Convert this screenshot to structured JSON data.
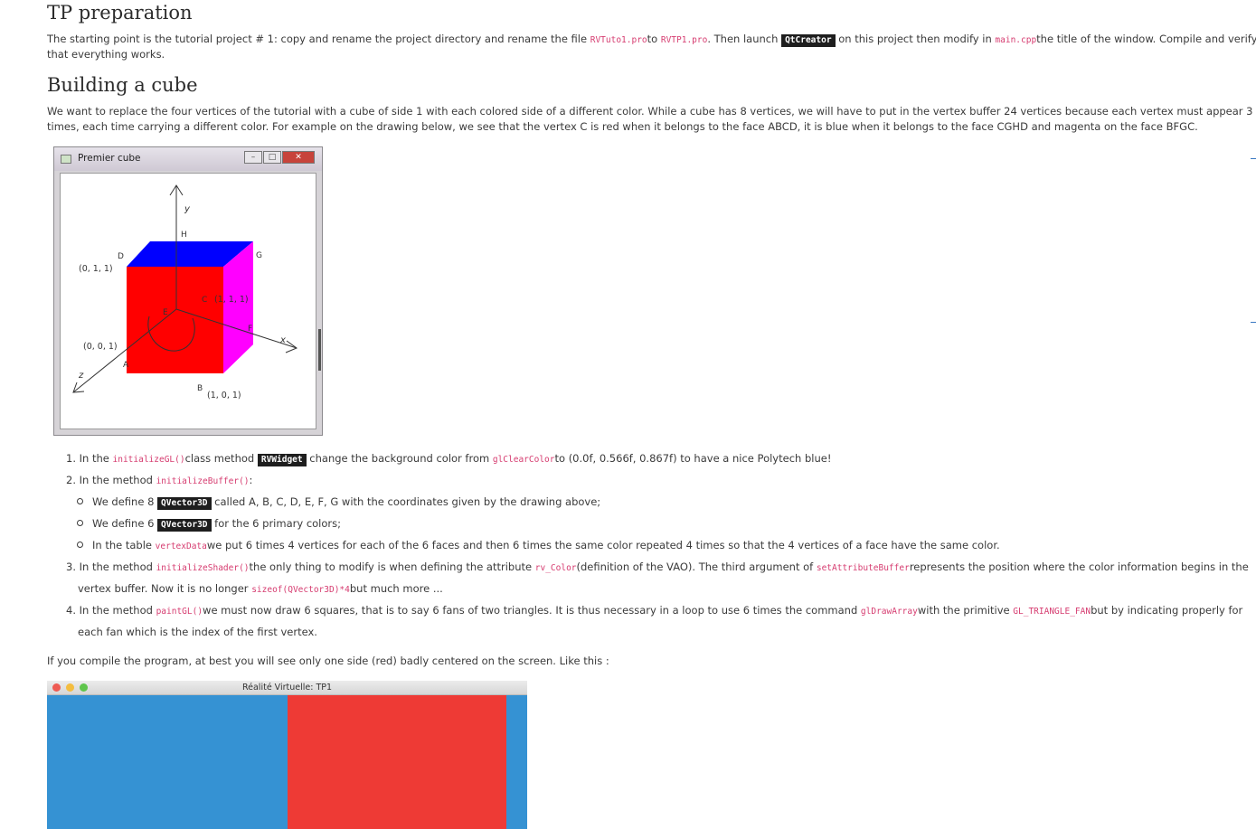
{
  "section1": {
    "title": "TP preparation",
    "p_parts": [
      "The starting point is the tutorial project # 1: copy and rename the project directory and rename the file ",
      "RVTuto1.pro",
      "to ",
      "RVTP1.pro",
      ". Then launch ",
      "QtCreator",
      " on this project then modify in ",
      "main.cpp",
      "the title of the window. Compile and verify"
    ],
    "p_line2": "that everything works."
  },
  "section2": {
    "title": "Building a cube",
    "p_line1": "We want to replace the four vertices of the tutorial with a cube of side 1 with each colored side of a different color. While a cube has 8 vertices, we will have to put in the vertex buffer 24 vertices because each vertex must appear 3",
    "p_line2": "times, each time carrying a different color. For example on the drawing below, we see that the vertex C is red when it belongs to the face ABCD, it is blue when it belongs to the face CGHD and magenta on the face BFGC."
  },
  "figure": {
    "window_title": "Premier cube",
    "colors": {
      "top": "#0000ff",
      "front": "#ff0000",
      "side": "#ff00ff"
    },
    "labels": {
      "y": "y",
      "x": "x",
      "z": "z",
      "H": "H",
      "G": "G",
      "D": "D",
      "C": "C",
      "E": "E",
      "F": "F",
      "A": "A",
      "B": "B",
      "d_coord": "(0, 1, 1)",
      "c_coord": "(1, 1, 1)",
      "a_coord": "(0, 0, 1)",
      "b_coord": "(1, 0, 1)"
    }
  },
  "steps": {
    "s1": [
      "1. In the ",
      "initializeGL()",
      "class method ",
      "RVWidget",
      " change the background color from ",
      "glClearColor",
      "to (0.0f, 0.566f, 0.867f) to have a nice Polytech blue!"
    ],
    "s2": [
      "2. In the method ",
      "initializeBuffer()",
      ":"
    ],
    "s2a": [
      "We define 8 ",
      "QVector3D",
      " called A, B, C, D, E, F, G with the coordinates given by the drawing above;"
    ],
    "s2b": [
      "We define 6 ",
      "QVector3D",
      " for the 6 primary colors;"
    ],
    "s2c": [
      "In the table ",
      "vertexData",
      "we put 6 times 4 vertices for each of the 6 faces and then 6 times the same color repeated 4 times so that the 4 vertices of a face have the same color."
    ],
    "s3": [
      "3. In the method ",
      "initializeShader()",
      "the only thing to modify is when defining the attribute ",
      "rv_Color",
      "(definition of the VAO). The third argument of ",
      "setAttributeBuffer",
      "represents the position where the color information begins in the"
    ],
    "s3b": [
      "vertex buffer. Now it is no longer ",
      "sizeof(QVector3D)*4",
      "but much more ..."
    ],
    "s4": [
      "4. In the method ",
      "paintGL()",
      "we must now draw 6 squares, that is to say 6 fans of two triangles. It is thus necessary in a loop to use 6 times the command ",
      "glDrawArray",
      "with the primitive ",
      "GL_TRIANGLE_FAN",
      "but by indicating properly for"
    ],
    "s4b": "each fan which is the index of the first vertex."
  },
  "closing": "If you compile the program, at best you will see only one side (red) badly centered on the screen. Like this :",
  "window2": {
    "title": "Réalité Virtuelle: TP1",
    "colors": {
      "background": "#3592d3",
      "face": "#ee3a35",
      "close": "#ee5a52",
      "min": "#f4bd3f",
      "max": "#5fc54c"
    }
  }
}
